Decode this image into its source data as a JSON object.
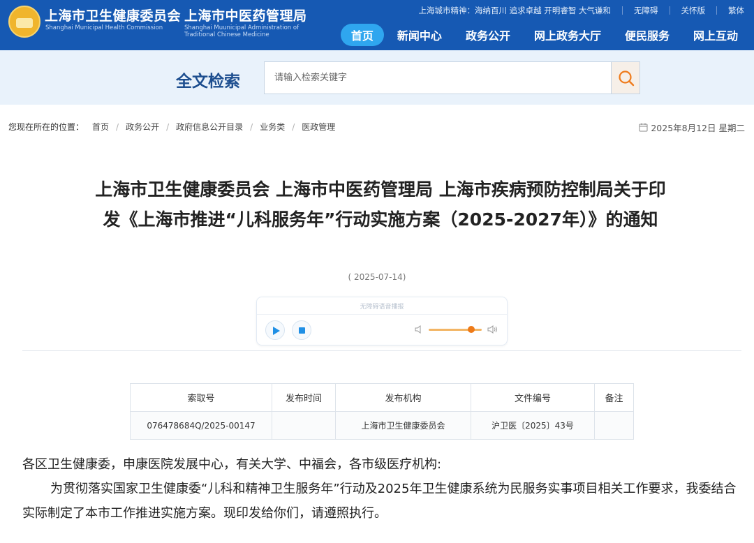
{
  "header": {
    "org_name_1": "上海市卫生健康委员会",
    "org_name_1_en": "Shanghai Municipal Health Commission",
    "org_name_2": "上海市中医药管理局",
    "org_name_2_en": "Shanghai Muunicipal Administration of Traditional Chinese Medicine",
    "spirit_text": "上海城市精神：海纳百川 追求卓越 开明睿智 大气谦和",
    "links": [
      "无障碍",
      "关怀版",
      "繁体"
    ],
    "nav": [
      "首页",
      "新闻中心",
      "政务公开",
      "网上政务大厅",
      "便民服务",
      "网上互动"
    ],
    "nav_active": "首页",
    "brand_color": "#1659b3",
    "active_color": "#2fa6ef"
  },
  "search": {
    "title": "全文检索",
    "placeholder": "请输入检索关键字",
    "button_icon": "search-icon"
  },
  "breadcrumb": {
    "lead": "您现在所在的位置：",
    "items": [
      "首页",
      "政务公开",
      "政府信息公开目录",
      "业务类",
      "医政管理"
    ]
  },
  "date": {
    "icon": "calendar-icon",
    "text": "2025年8月12日 星期二"
  },
  "article": {
    "title": "上海市卫生健康委员会 上海市中医药管理局 上海市疾病预防控制局关于印发《上海市推进“儿科服务年”行动实施方案（2025-2027年）》的通知",
    "pub_date": "( 2025-07-14)"
  },
  "player": {
    "caption": "无障碍语音播报",
    "controls": [
      "play-icon",
      "stop-icon",
      "volume-low-icon",
      "volume-high-icon"
    ],
    "volume_level": 0.75
  },
  "meta_table": {
    "headers": [
      "索取号",
      "发布时间",
      "发布机构",
      "文件编号",
      "备注"
    ],
    "values": [
      "076478684Q/2025-00147",
      "",
      "上海市卫生健康委员会",
      "沪卫医〔2025〕43号",
      ""
    ]
  },
  "body": {
    "salutation": "各区卫生健康委，申康医院发展中心，有关大学、中福会，各市级医疗机构:",
    "paragraph": "为贯彻落实国家卫生健康委“儿科和精神卫生服务年”行动及2025年卫生健康系统为民服务实事项目相关工作要求，我委结合实际制定了本市工作推进实施方案。现印发给你们，请遵照执行。"
  }
}
